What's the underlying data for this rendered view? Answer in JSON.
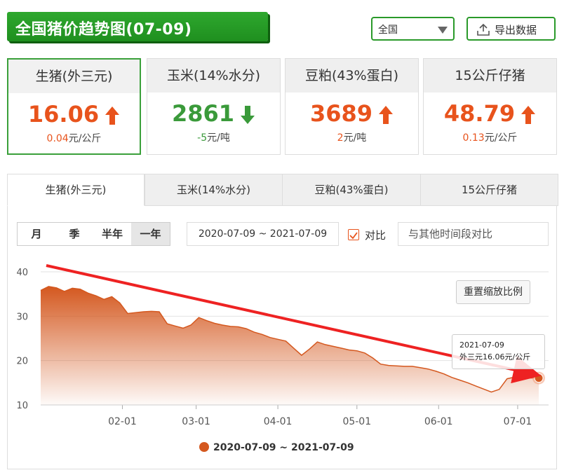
{
  "header": {
    "title": "全国猪价趋势图(07-09)",
    "region_select_value": "全国",
    "export_label": "导出数据"
  },
  "cards": [
    {
      "name": "生猪(外三元)",
      "value": "16.06",
      "direction": "up",
      "change": "0.04",
      "unit": "元/公斤"
    },
    {
      "name": "玉米(14%水分)",
      "value": "2861",
      "direction": "down",
      "change": "-5",
      "unit": "元/吨"
    },
    {
      "name": "豆粕(43%蛋白)",
      "value": "3689",
      "direction": "up",
      "change": "2",
      "unit": "元/吨"
    },
    {
      "name": "15公斤仔猪",
      "value": "48.79",
      "direction": "up",
      "change": "0.13",
      "unit": "元/公斤"
    }
  ],
  "tabs": [
    "生猪(外三元)",
    "玉米(14%水分)",
    "豆粕(43%蛋白)",
    "15公斤仔猪"
  ],
  "range_buttons": [
    "月",
    "季",
    "半年",
    "一年"
  ],
  "date_range": "2020-07-09 ~ 2021-07-09",
  "compare_label": "对比",
  "compare_placeholder": "与其他时间段对比",
  "reset_zoom_label": "重置缩放比例",
  "tooltip": {
    "date": "2021-07-09",
    "text": "外三元16.06元/公斤"
  },
  "colors": {
    "accent_green": "#2ea82e",
    "up": "#e8531c",
    "down": "#3a9a3a",
    "series": "#d4581f",
    "arrow": "#ee2222"
  },
  "chart_data": {
    "type": "area",
    "y_ticks": [
      10,
      20,
      30,
      40
    ],
    "x_ticks": [
      "02-01",
      "03-01",
      "04-01",
      "05-01",
      "06-01",
      "07-01"
    ],
    "ylim": [
      10,
      40
    ],
    "series": [
      {
        "name": "2020-07-09 ~ 2021-07-09",
        "x": [
          "2021-01-01",
          "2021-01-04",
          "2021-01-07",
          "2021-01-10",
          "2021-01-13",
          "2021-01-16",
          "2021-01-19",
          "2021-01-22",
          "2021-01-25",
          "2021-01-28",
          "2021-01-31",
          "2021-02-03",
          "2021-02-06",
          "2021-02-09",
          "2021-02-12",
          "2021-02-15",
          "2021-02-18",
          "2021-02-21",
          "2021-02-24",
          "2021-02-27",
          "2021-03-02",
          "2021-03-05",
          "2021-03-08",
          "2021-03-11",
          "2021-03-14",
          "2021-03-17",
          "2021-03-20",
          "2021-03-23",
          "2021-03-26",
          "2021-03-29",
          "2021-04-01",
          "2021-04-04",
          "2021-04-07",
          "2021-04-10",
          "2021-04-13",
          "2021-04-16",
          "2021-04-19",
          "2021-04-22",
          "2021-04-25",
          "2021-04-28",
          "2021-05-01",
          "2021-05-04",
          "2021-05-07",
          "2021-05-10",
          "2021-05-13",
          "2021-05-16",
          "2021-05-19",
          "2021-05-22",
          "2021-05-25",
          "2021-05-28",
          "2021-05-31",
          "2021-06-03",
          "2021-06-06",
          "2021-06-09",
          "2021-06-12",
          "2021-06-15",
          "2021-06-18",
          "2021-06-21",
          "2021-06-24",
          "2021-06-27",
          "2021-06-30",
          "2021-07-03",
          "2021-07-06",
          "2021-07-09"
        ],
        "values": [
          35.8,
          36.7,
          36.4,
          35.6,
          36.3,
          36.1,
          35.2,
          34.6,
          33.8,
          34.4,
          33.0,
          30.6,
          30.8,
          31.0,
          31.1,
          31.0,
          28.3,
          27.8,
          27.3,
          28.0,
          29.7,
          29.0,
          28.4,
          28.0,
          27.7,
          27.6,
          27.2,
          26.4,
          25.9,
          25.2,
          24.8,
          24.4,
          22.8,
          21.2,
          22.6,
          24.2,
          23.6,
          23.2,
          22.8,
          22.4,
          22.2,
          21.7,
          20.6,
          19.2,
          18.9,
          18.8,
          18.7,
          18.7,
          18.4,
          18.1,
          17.6,
          17.0,
          16.2,
          15.6,
          15.0,
          14.3,
          13.6,
          12.9,
          13.5,
          15.9,
          16.3,
          16.0,
          16.1,
          16.06
        ]
      }
    ]
  }
}
